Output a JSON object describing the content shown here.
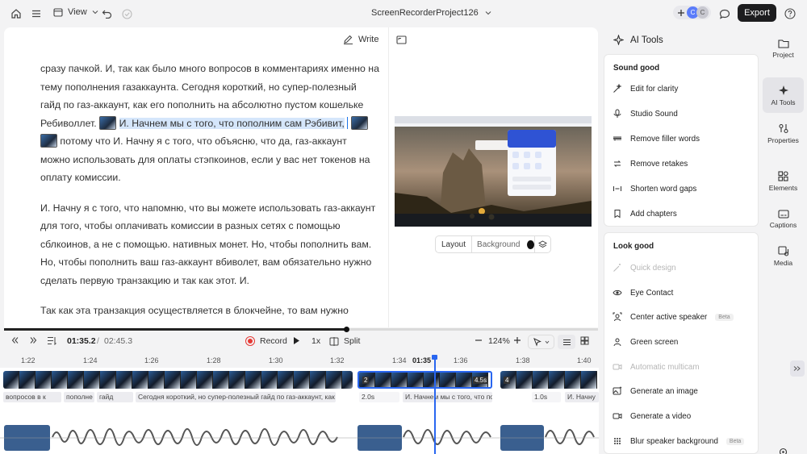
{
  "topbar": {
    "view_label": "View",
    "project_name": "ScreenRecorderProject126",
    "avatar_1": "C",
    "avatar_2": "C",
    "export_label": "Export"
  },
  "editor": {
    "write_label": "Write",
    "script_p1_a": "сразу пачкой. И, так как было много вопросов в комментариях именно на тему пополнения газаккаунта. Сегодня короткий, но супер-полезный гайд по газ-аккаунт, как его пополнить на абсолютно пустом кошельке Ребиволлет.",
    "script_p1_hl": "И. Начнем мы с того, что пополним сам Рэбивит,",
    "script_p1_b": "потому что И. Начну я с того, что объясню, что да, газ-аккаунт можно использовать для оплаты стэпкоинов, если у вас нет токенов на оплату комиссии.",
    "script_p2": "И. Начну я с того, что напомню, что вы можете использовать газ-аккаунт для того, чтобы оплачивать комиссии в разных сетях с помощью сблкоинов, а не с помощью. нативных монет. Но, чтобы пополнить вам. Но, чтобы пополнить ваш газ-аккаунт вбиволет, вам обязательно нужно сделать первую транзакцию и так как этот. И.",
    "script_p3": "Так как эта транзакция осуществляется в блокчейне, то вам нужно",
    "layout_label": "Layout",
    "background_label": "Background"
  },
  "controls": {
    "current_time": "01:35.2",
    "separator": "/",
    "total_time": "02:45.3",
    "record_label": "Record",
    "speed_label": "1x",
    "split_label": "Split",
    "zoom_label": "124%"
  },
  "ruler": {
    "ticks": [
      "1:22",
      "1:24",
      "1:26",
      "1:28",
      "1:30",
      "1:32",
      "1:34",
      "1:36",
      "1:38",
      "1:40"
    ],
    "current": "01:35"
  },
  "timeline": {
    "cap_1": "вопросов в к",
    "cap_2": "пополне",
    "cap_3": "гайд",
    "cap_4": "Сегодня короткий, но супер-полезный гайд по газ-аккаунт, как е",
    "cap_5": "2.0s",
    "cap_6": "И. Начнем мы с того, что пополним са",
    "cap_7": "1.0s",
    "cap_8": "И. Начну",
    "clip_num_a": "2",
    "clip_num_b": "4",
    "clip_dur": "4.5s"
  },
  "ai_panel": {
    "title": "AI Tools",
    "sound_title": "Sound good",
    "sound_items": [
      "Edit for clarity",
      "Studio Sound",
      "Remove filler words",
      "Remove retakes",
      "Shorten word gaps",
      "Add chapters"
    ],
    "look_title": "Look good",
    "look_items": [
      "Quick design",
      "Eye Contact",
      "Center active speaker",
      "Green screen",
      "Automatic multicam",
      "Generate an image",
      "Generate a video",
      "Blur speaker background"
    ],
    "beta": "Beta"
  },
  "rail": {
    "items": [
      "Project",
      "AI Tools",
      "Properties",
      "Elements",
      "Captions",
      "Media"
    ]
  },
  "colors": {
    "accent": "#2966f0",
    "export_bg": "#1d1d1f",
    "record_red": "#e53935"
  }
}
